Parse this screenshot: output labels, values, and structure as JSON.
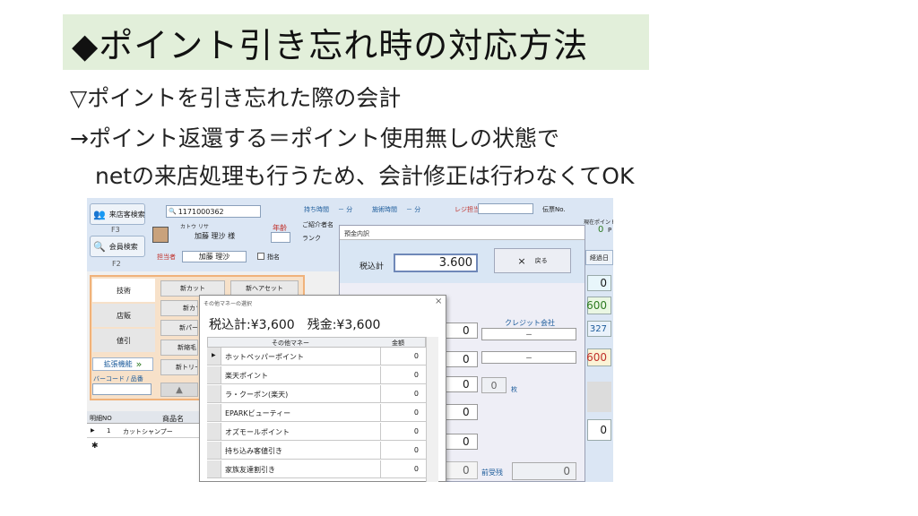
{
  "slide": {
    "title": "◆ポイント引き忘れ時の対応方法",
    "line1": "▽ポイントを引き忘れた際の会計",
    "line2": "→ポイント返還する＝ポイント使用無しの状態で",
    "line3": "netの来店処理も行うため、会計修正は行わなくてOK"
  },
  "app": {
    "left_buttons": [
      {
        "label": "来店客検索",
        "key": "F3"
      },
      {
        "label": "会員検索",
        "key": "F2"
      }
    ],
    "member": {
      "search_value": "1171000362",
      "kana": "カトウ リサ",
      "name": "加藤 理沙 様",
      "age_label": "年齢"
    },
    "staff": {
      "label": "担当者",
      "name": "加藤 理沙",
      "nominate_label": "指名"
    },
    "info": {
      "hold_time_label": "持ち時間",
      "hold_time_value": "－ 分",
      "treat_time_label": "施術時間",
      "treat_time_value": "－ 分",
      "referrer_label": "ご紹介者名",
      "rank_label": "ランク",
      "register_label": "レジ担当",
      "slip_label": "伝票No."
    },
    "right_panel": {
      "point_label": "現在ポイント",
      "point_value": "0",
      "point_unit": "P",
      "date_label": "経過日",
      "values": [
        "0",
        "600",
        "327",
        "600",
        "0"
      ]
    },
    "tabs": [
      "技術",
      "店販",
      "値引"
    ],
    "expand_label": "拡張機能",
    "expand_arrow": "»",
    "barcode_label": "バーコード / 品番",
    "menu_buttons": [
      "新カット",
      "新ヘアセット",
      "新カラー",
      "新パーマ",
      "新縮毛",
      "新トリートメント"
    ],
    "detail_grid": {
      "columns": [
        "明細NO",
        "商品名"
      ],
      "rows": [
        {
          "no": "1",
          "name": "カットシャンプー"
        }
      ]
    }
  },
  "deposit_dialog": {
    "title": "預金内訳",
    "total_label": "税込計",
    "total_value": "3.600",
    "back_label": "戻る",
    "back_icon": "×",
    "amounts": [
      "0",
      "0",
      "0",
      "0",
      "0",
      "0",
      "0"
    ],
    "credit_label": "クレジット会社",
    "credit_value1": "－",
    "credit_value2": "－",
    "count_value": "0",
    "count_unit": "枚",
    "prev_label": "前受残",
    "prev_value": "0"
  },
  "other_money_dialog": {
    "title": "その他マネーの選択",
    "summary": "税込計:¥3,600　残金:¥3,600",
    "col_name": "その他マネー",
    "col_amount": "金額",
    "rows": [
      {
        "name": "ホットペッパーポイント",
        "amount": "0"
      },
      {
        "name": "楽天ポイント",
        "amount": "0"
      },
      {
        "name": "ラ・クーポン(楽天)",
        "amount": "0"
      },
      {
        "name": "EPARKビューティー",
        "amount": "0"
      },
      {
        "name": "オズモールポイント",
        "amount": "0"
      },
      {
        "name": "持ち込み客値引き",
        "amount": "0"
      },
      {
        "name": "家族友達割引き",
        "amount": "0"
      }
    ]
  },
  "colors": {
    "title_bg": "#e2efda",
    "app_blue": "#dbe6f4",
    "accent_green": "#2c7a20",
    "accent_red": "#c0302a"
  }
}
